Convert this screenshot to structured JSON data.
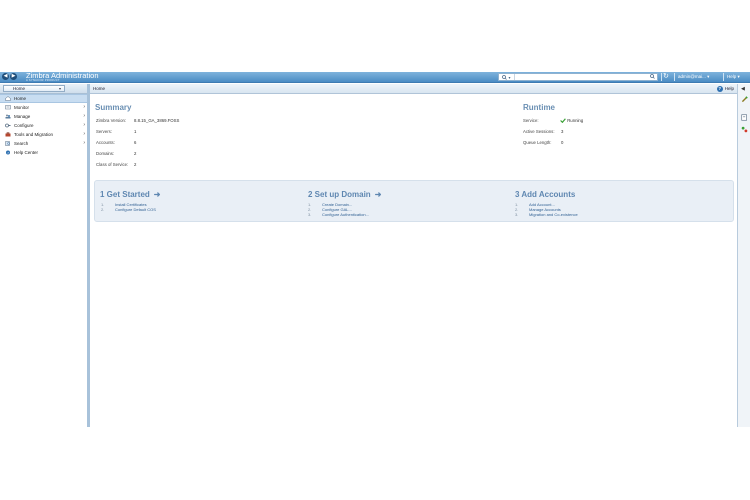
{
  "topbar": {
    "app_title": "Zimbra Administration",
    "app_subtitle": "A SYNACOR PRODUCT",
    "user_menu": "admin@mai...",
    "help_menu": "Help",
    "back_icon": "arrow-left-icon",
    "forward_icon": "arrow-right-icon",
    "search_scope_icon": "search-scope-icon",
    "search_go_icon": "magnifier-icon",
    "refresh_icon": "refresh-icon"
  },
  "sidebar": {
    "selector_label": "Home",
    "items": [
      {
        "label": "Home",
        "icon": "home-icon",
        "selected": true,
        "has_children": false
      },
      {
        "label": "Monitor",
        "icon": "monitor-icon",
        "selected": false,
        "has_children": true
      },
      {
        "label": "Manage",
        "icon": "manage-users-icon",
        "selected": false,
        "has_children": true
      },
      {
        "label": "Configure",
        "icon": "configure-icon",
        "selected": false,
        "has_children": true
      },
      {
        "label": "Tools and Migration",
        "icon": "toolbox-icon",
        "selected": false,
        "has_children": true
      },
      {
        "label": "Search",
        "icon": "search-icon",
        "selected": false,
        "has_children": true
      },
      {
        "label": "Help Center",
        "icon": "help-icon",
        "selected": false,
        "has_children": false
      }
    ]
  },
  "main": {
    "tab_title": "Home",
    "help_label": "Help",
    "summary": {
      "title": "Summary",
      "rows": [
        {
          "label": "Zimbra Version:",
          "value": "8.8.15_GA_3869.FOSS"
        },
        {
          "label": "Servers:",
          "value": "1"
        },
        {
          "label": "Accounts:",
          "value": "6"
        },
        {
          "label": "Domains:",
          "value": "2"
        },
        {
          "label": "Class of Service:",
          "value": "2"
        }
      ]
    },
    "runtime": {
      "title": "Runtime",
      "rows": [
        {
          "label": "Service:",
          "value": "Running"
        },
        {
          "label": "Active Sessions:",
          "value": "3"
        },
        {
          "label": "Queue Length:",
          "value": "0"
        }
      ]
    },
    "getting_started": [
      {
        "title": "1 Get Started",
        "steps": [
          {
            "num": "1.",
            "label": "Install Certificates"
          },
          {
            "num": "2.",
            "label": "Configure Default COS"
          }
        ]
      },
      {
        "title": "2 Set up Domain",
        "steps": [
          {
            "num": "1.",
            "label": "Create Domain..."
          },
          {
            "num": "2.",
            "label": "Configure GAL..."
          },
          {
            "num": "3.",
            "label": "Configure Authentication..."
          }
        ]
      },
      {
        "title": "3 Add Accounts",
        "steps": [
          {
            "num": "1.",
            "label": "Add Account..."
          },
          {
            "num": "2.",
            "label": "Manage Accounts"
          },
          {
            "num": "3.",
            "label": "Migration and Co-existence"
          }
        ]
      }
    ]
  },
  "colors": {
    "banner": "#4b8cc4",
    "section_title": "#6a8fb3",
    "link": "#2f5f92",
    "running_green": "#3aa035"
  }
}
